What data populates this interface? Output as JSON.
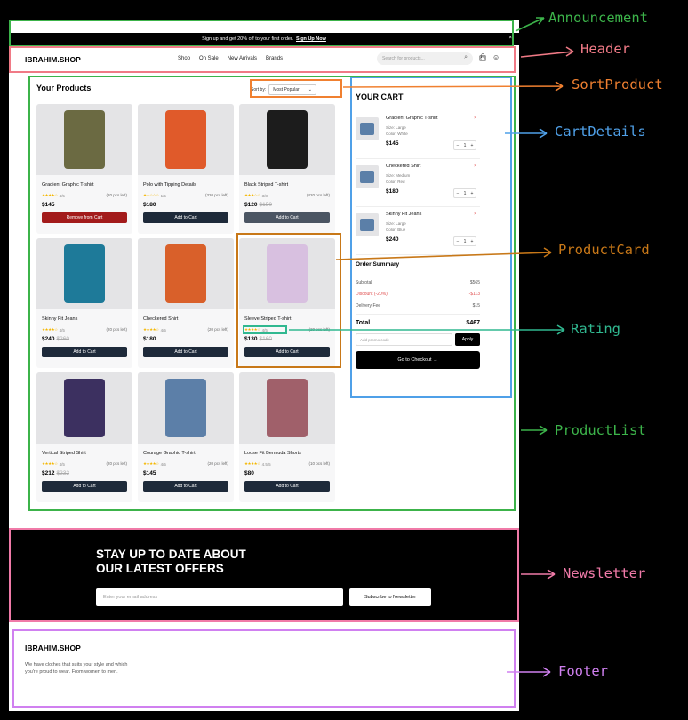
{
  "announcement": {
    "text": "Sign up and get 20% off to your first order.",
    "link": "Sign Up Now",
    "close": "×"
  },
  "header": {
    "logo": "IBRAHIM.SHOP",
    "nav": [
      "Shop",
      "On Sale",
      "New Arrivals",
      "Brands"
    ],
    "search_placeholder": "Search for products..."
  },
  "products": {
    "title": "Your Products",
    "sort_label": "Sort by:",
    "sort_value": "Most Popular",
    "items": [
      {
        "name": "Gradient Graphic T-shirt",
        "rating": "4/5",
        "stars": 4,
        "stock": "(20 pcs left)",
        "price": "$145",
        "old": "",
        "button": "Remove from Cart",
        "btn_style": "red",
        "color": "#6b6a42"
      },
      {
        "name": "Polo with Tipping Details",
        "rating": "1/5",
        "stars": 1,
        "stock": "(320 pcs left)",
        "price": "$180",
        "old": "",
        "button": "Add to Cart",
        "btn_style": "",
        "color": "#e05a2a"
      },
      {
        "name": "Black Striped T-shirt",
        "rating": "3/3",
        "stars": 3,
        "stock": "(420 pcs left)",
        "price": "$120",
        "old": "$150",
        "button": "Add to Cart",
        "btn_style": "dim",
        "color": "#1c1c1c"
      },
      {
        "name": "Skinny Fit Jeans",
        "rating": "4/5",
        "stars": 4,
        "stock": "(20 pcs left)",
        "price": "$240",
        "old": "$260",
        "button": "Add to Cart",
        "btn_style": "",
        "color": "#1e7a99"
      },
      {
        "name": "Checkered Shirt",
        "rating": "4/5",
        "stars": 4,
        "stock": "(20 pcs left)",
        "price": "$180",
        "old": "",
        "button": "Add to Cart",
        "btn_style": "",
        "color": "#d9602a"
      },
      {
        "name": "Sleeve Striped T-shirt",
        "rating": "4/5",
        "stars": 4,
        "stock": "(20 pcs left)",
        "price": "$130",
        "old": "$160",
        "button": "Add to Cart",
        "btn_style": "",
        "color": "#d8c0e0"
      },
      {
        "name": "Vertical Striped Shirt",
        "rating": "4/5",
        "stars": 4,
        "stock": "(20 pcs left)",
        "price": "$212",
        "old": "$232",
        "button": "Add to Cart",
        "btn_style": "",
        "color": "#3c3060"
      },
      {
        "name": "Courage Graphic T-shirt",
        "rating": "4/5",
        "stars": 4,
        "stock": "(20 pcs left)",
        "price": "$145",
        "old": "",
        "button": "Add to Cart",
        "btn_style": "",
        "color": "#5c7fa8"
      },
      {
        "name": "Loose Fit Bermuda Shorts",
        "rating": "4.5/5",
        "stars": 4,
        "stock": "(10 pcs left)",
        "price": "$80",
        "old": "",
        "button": "Add to Cart",
        "btn_style": "",
        "color": "#a0606a"
      }
    ]
  },
  "cart": {
    "title": "YOUR CART",
    "items": [
      {
        "name": "Gradient Graphic T-shirt",
        "size": "Size: Large",
        "color": "Color: White",
        "price": "$145",
        "qty": "1"
      },
      {
        "name": "Checkered Shirt",
        "size": "Size: Medium",
        "color": "Color: Red",
        "price": "$180",
        "qty": "1"
      },
      {
        "name": "Skinny Fit Jeans",
        "size": "Size: Large",
        "color": "Color: Blue",
        "price": "$240",
        "qty": "1"
      }
    ],
    "summary": {
      "title": "Order Summary",
      "subtotal_label": "Subtotal",
      "subtotal": "$565",
      "discount_label": "Discount (-20%)",
      "discount": "-$113",
      "delivery_label": "Delivery Fee",
      "delivery": "$15",
      "total_label": "Total",
      "total": "$467"
    },
    "promo_placeholder": "Add promo code",
    "apply": "Apply",
    "checkout": "Go to Checkout"
  },
  "newsletter": {
    "heading_line1": "STAY UP TO DATE ABOUT",
    "heading_line2": "OUR LATEST OFFERS",
    "email_placeholder": "Enter your email address",
    "button": "Subscribe to Newsletter"
  },
  "footer": {
    "logo": "IBRAHIM.SHOP",
    "description": "We have clothes that suits your style and which you're proud to wear. From women to men."
  },
  "annotations": [
    {
      "label": "Announcement",
      "color": "#3cb34a"
    },
    {
      "label": "Header",
      "color": "#f07a86"
    },
    {
      "label": "SortProduct",
      "color": "#f08030"
    },
    {
      "label": "CartDetails",
      "color": "#4fa0e8"
    },
    {
      "label": "ProductCard",
      "color": "#c87818"
    },
    {
      "label": "Rating",
      "color": "#30b890"
    },
    {
      "label": "ProductList",
      "color": "#3cb34a"
    },
    {
      "label": "Newsletter",
      "color": "#f07aa8"
    },
    {
      "label": "Footer",
      "color": "#d080f0"
    }
  ]
}
